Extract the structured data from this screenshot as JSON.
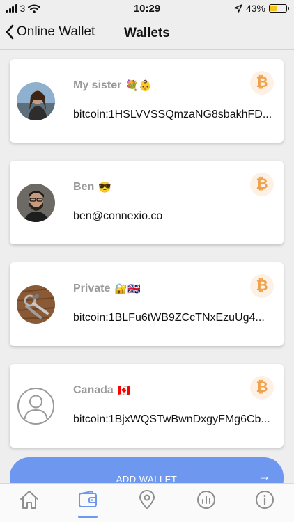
{
  "status_bar": {
    "carrier": "3",
    "time": "10:29",
    "battery_percent": "43%",
    "battery_level": 0.43
  },
  "nav": {
    "back_label": "Online Wallet",
    "title": "Wallets"
  },
  "wallets": [
    {
      "name": "My sister",
      "emoji": "💐👶",
      "address": "bitcoin:1HSLVVSSQmzaNG8sbakhFD...",
      "currency_symbol": "₿",
      "avatar": "photo-woman"
    },
    {
      "name": "Ben",
      "emoji": "😎",
      "address": "ben@connexio.co",
      "currency_symbol": "₿",
      "avatar": "photo-man"
    },
    {
      "name": "Private",
      "emoji": "🔐🇬🇧",
      "address": "bitcoin:1BLFu6tWB9ZCcTNxEzuUg4...",
      "currency_symbol": "₿",
      "avatar": "photo-keys"
    },
    {
      "name": "Canada",
      "emoji": "🇨🇦",
      "address": "bitcoin:1BjxWQSTwBwnDxgyFMg6Cb...",
      "currency_symbol": "₿",
      "avatar": "default-user-icon"
    }
  ],
  "add_wallet": {
    "label": "ADD WALLET",
    "arrow": "→"
  },
  "tabs": [
    {
      "icon": "home-icon"
    },
    {
      "icon": "wallet-icon",
      "active": true
    },
    {
      "icon": "map-pin-icon"
    },
    {
      "icon": "chart-icon"
    },
    {
      "icon": "info-icon"
    }
  ],
  "colors": {
    "accent": "#6e97f0",
    "bitcoin": "#f0a24b",
    "name_gray": "#9a9a9a",
    "background": "#eeeeee"
  }
}
